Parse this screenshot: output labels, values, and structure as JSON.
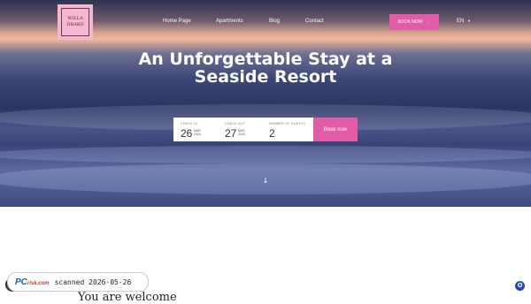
{
  "logo": {
    "line1": "WILLA",
    "line2": "DRAKO"
  },
  "nav": {
    "items": [
      "Home Page",
      "Apartments",
      "Blog",
      "Contact"
    ]
  },
  "header": {
    "book_label": "BOOK NOW",
    "lang": "EN"
  },
  "hero": {
    "title": "An Unforgettable Stay at a Seaside Resort"
  },
  "booking": {
    "checkin_label": "CHECK IN",
    "checkin_day": "26",
    "checkin_month": "MAR",
    "checkin_year": "2026",
    "checkout_label": "CHECK OUT",
    "checkout_day": "27",
    "checkout_month": "MAR",
    "checkout_year": "2026",
    "guests_label": "NUMBER OF GUESTS",
    "guests_value": "2",
    "button": "Book now"
  },
  "welcome": {
    "heading": "You are welcome"
  },
  "watermark": {
    "brand": "PC",
    "brand_suffix": "risk.com",
    "text": "scanned 2026-05-26"
  },
  "icons": {
    "scroll": "arrow-down-icon",
    "accessibility": "accessibility-icon",
    "dropdown": "chevron-down-icon"
  }
}
